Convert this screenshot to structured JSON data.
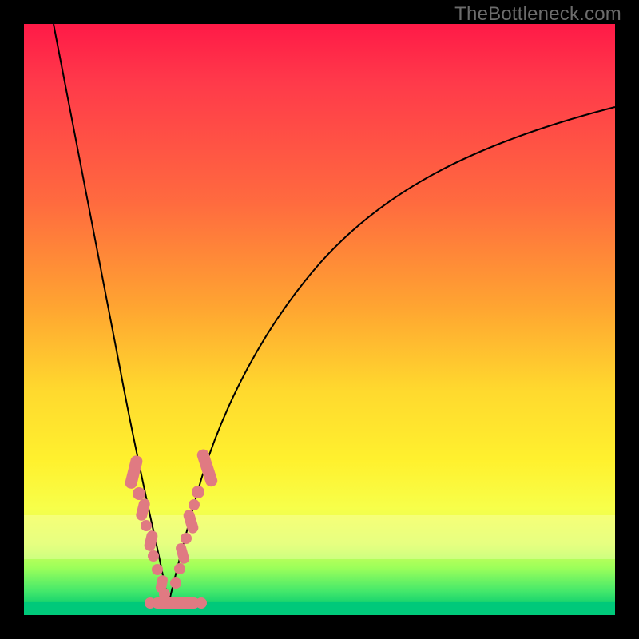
{
  "watermark": "TheBottleneck.com",
  "chart_data": {
    "type": "line",
    "title": "",
    "xlabel": "",
    "ylabel": "",
    "xlim": [
      0,
      100
    ],
    "ylim": [
      0,
      100
    ],
    "grid": false,
    "legend": false,
    "series": [
      {
        "name": "left-branch",
        "x": [
          5,
          8,
          11,
          14,
          16,
          18,
          20,
          21.5,
          23,
          24
        ],
        "y": [
          100,
          80,
          60,
          44,
          32,
          22,
          14,
          8,
          3,
          0
        ]
      },
      {
        "name": "right-branch",
        "x": [
          24,
          26,
          28,
          30,
          33,
          38,
          45,
          55,
          70,
          85,
          100
        ],
        "y": [
          0,
          6,
          14,
          22,
          32,
          44,
          56,
          66,
          76,
          82,
          86
        ]
      }
    ],
    "markers": {
      "description": "salmon capsule/dot markers clustered near the V vertex",
      "left_branch_points": [
        {
          "x": 18.3,
          "y": 24
        },
        {
          "x": 18.9,
          "y": 21
        },
        {
          "x": 19.6,
          "y": 17
        },
        {
          "x": 20.1,
          "y": 14.5
        },
        {
          "x": 20.8,
          "y": 11
        },
        {
          "x": 21.5,
          "y": 8
        },
        {
          "x": 22.0,
          "y": 6
        },
        {
          "x": 22.7,
          "y": 3.5
        },
        {
          "x": 23.3,
          "y": 1.8
        }
      ],
      "right_branch_points": [
        {
          "x": 25.7,
          "y": 5
        },
        {
          "x": 26.5,
          "y": 8
        },
        {
          "x": 27.2,
          "y": 11
        },
        {
          "x": 27.9,
          "y": 14
        },
        {
          "x": 28.6,
          "y": 17
        },
        {
          "x": 29.4,
          "y": 20
        },
        {
          "x": 30.2,
          "y": 23
        },
        {
          "x": 31.0,
          "y": 26
        }
      ],
      "bottom_row_points": [
        {
          "x": 22.0,
          "y": 0.6
        },
        {
          "x": 23.0,
          "y": 0.6
        },
        {
          "x": 24.0,
          "y": 0.6
        },
        {
          "x": 25.0,
          "y": 0.6
        },
        {
          "x": 26.0,
          "y": 0.6
        }
      ]
    },
    "background_gradient": {
      "top": "#ff1a47",
      "mid_upper": "#ffa531",
      "mid_lower": "#fff12e",
      "bottom": "#00c97a"
    }
  }
}
